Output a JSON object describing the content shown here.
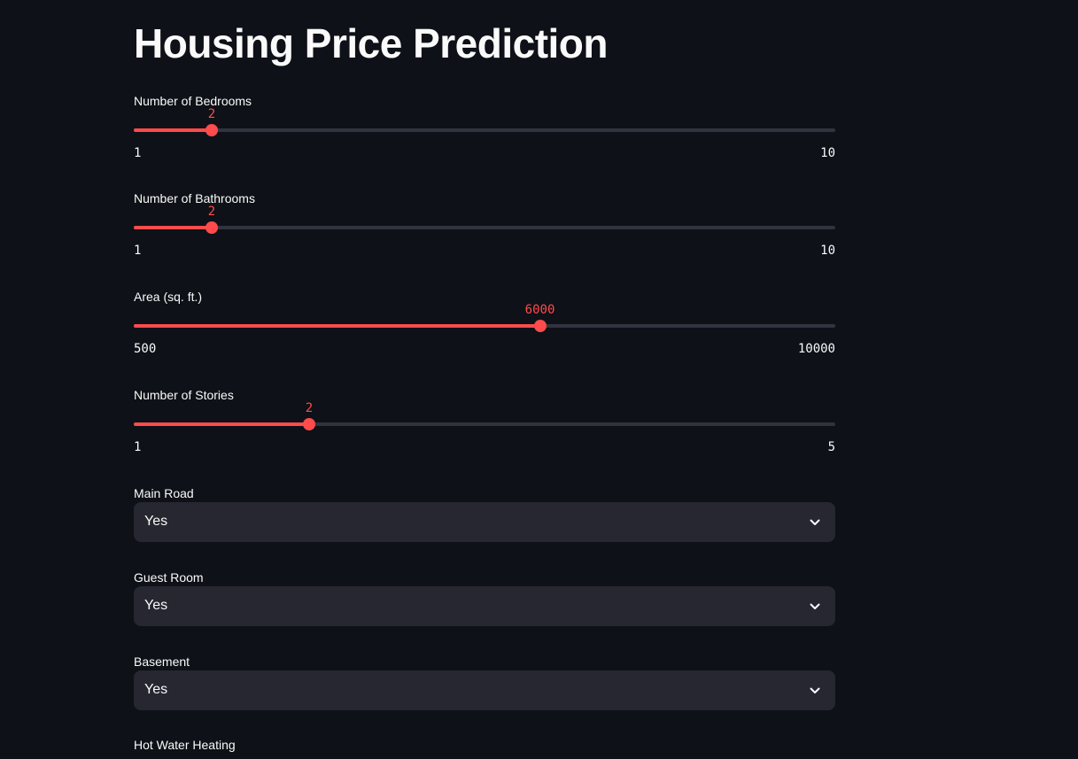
{
  "page": {
    "title": "Housing Price Prediction"
  },
  "sliders": [
    {
      "label": "Number of Bedrooms",
      "value": 2,
      "min": 1,
      "max": 10,
      "value_text": "2",
      "min_text": "1",
      "max_text": "10"
    },
    {
      "label": "Number of Bathrooms",
      "value": 2,
      "min": 1,
      "max": 10,
      "value_text": "2",
      "min_text": "1",
      "max_text": "10"
    },
    {
      "label": "Area (sq. ft.)",
      "value": 6000,
      "min": 500,
      "max": 10000,
      "value_text": "6000",
      "min_text": "500",
      "max_text": "10000"
    },
    {
      "label": "Number of Stories",
      "value": 2,
      "min": 1,
      "max": 5,
      "value_text": "2",
      "min_text": "1",
      "max_text": "5"
    }
  ],
  "selects": [
    {
      "label": "Main Road",
      "value": "Yes"
    },
    {
      "label": "Guest Room",
      "value": "Yes"
    },
    {
      "label": "Basement",
      "value": "Yes"
    },
    {
      "label": "Hot Water Heating",
      "value": ""
    }
  ],
  "colors": {
    "background": "#0e1117",
    "accent": "#ff4b4b",
    "track": "#31333f",
    "select_bg": "#262730",
    "text": "#fafafa"
  },
  "icons": {
    "select_arrow": "chevron-down-icon"
  }
}
